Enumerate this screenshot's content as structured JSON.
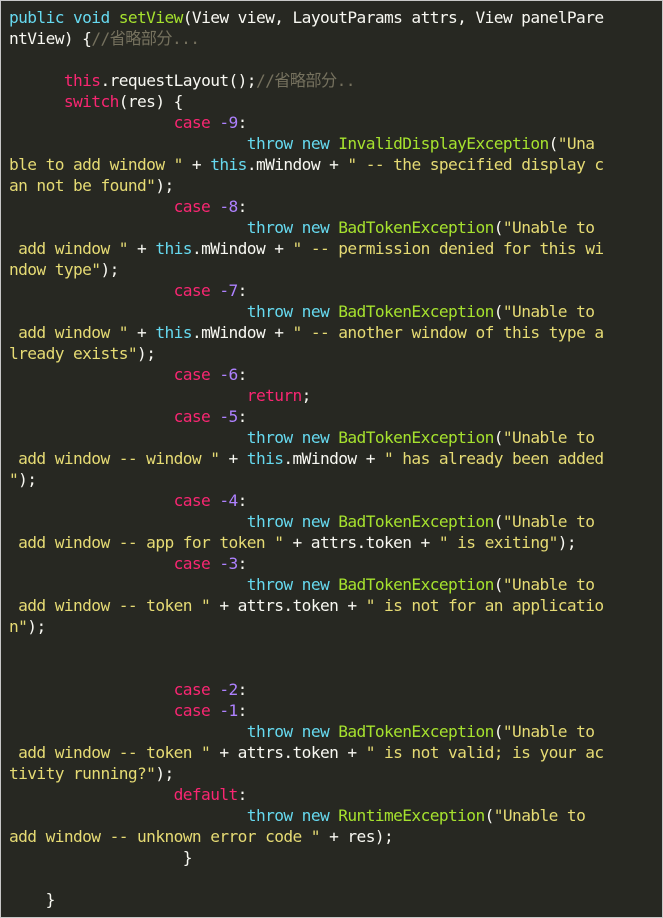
{
  "colors": {
    "background": "#272822",
    "keyword_blue": "#66d9ef",
    "keyword_pink": "#f92672",
    "function_green": "#a6e22e",
    "string_yellow": "#e6db74",
    "number_purple": "#ae81ff",
    "comment_gray": "#75715e",
    "plain": "#f8f8f2"
  },
  "lines": [
    [
      {
        "t": "kw-blue",
        "v": "public void "
      },
      {
        "t": "fn",
        "v": "setView"
      },
      {
        "t": "pl",
        "v": "(View view, LayoutParams attrs, View panelPare"
      }
    ],
    [
      {
        "t": "pl",
        "v": "ntView) {"
      },
      {
        "t": "cmt",
        "v": "//省略部分..."
      }
    ],
    [
      {
        "t": "pl",
        "v": ""
      }
    ],
    [
      {
        "t": "pl",
        "v": "      "
      },
      {
        "t": "kw-pink",
        "v": "this"
      },
      {
        "t": "pl",
        "v": ".requestLayout();"
      },
      {
        "t": "cmt",
        "v": "//省略部分.."
      }
    ],
    [
      {
        "t": "pl",
        "v": "      "
      },
      {
        "t": "kw-pink",
        "v": "switch"
      },
      {
        "t": "pl",
        "v": "(res) {"
      }
    ],
    [
      {
        "t": "pl",
        "v": "                  "
      },
      {
        "t": "kw-pink",
        "v": "case "
      },
      {
        "t": "num",
        "v": "-9"
      },
      {
        "t": "pl",
        "v": ":"
      }
    ],
    [
      {
        "t": "pl",
        "v": "                          "
      },
      {
        "t": "kw-blue",
        "v": "throw new "
      },
      {
        "t": "cls",
        "v": "InvalidDisplayException"
      },
      {
        "t": "pl",
        "v": "("
      },
      {
        "t": "str",
        "v": "\"Una"
      }
    ],
    [
      {
        "t": "str",
        "v": "ble to add window \""
      },
      {
        "t": "pl",
        "v": " + "
      },
      {
        "t": "kw-blue",
        "v": "this"
      },
      {
        "t": "pl",
        "v": ".mWindow + "
      },
      {
        "t": "str",
        "v": "\" -- the specified display c"
      }
    ],
    [
      {
        "t": "str",
        "v": "an not be found\""
      },
      {
        "t": "pl",
        "v": ");"
      }
    ],
    [
      {
        "t": "pl",
        "v": "                  "
      },
      {
        "t": "kw-pink",
        "v": "case "
      },
      {
        "t": "num",
        "v": "-8"
      },
      {
        "t": "pl",
        "v": ":"
      }
    ],
    [
      {
        "t": "pl",
        "v": "                          "
      },
      {
        "t": "kw-blue",
        "v": "throw new "
      },
      {
        "t": "cls",
        "v": "BadTokenException"
      },
      {
        "t": "pl",
        "v": "("
      },
      {
        "t": "str",
        "v": "\"Unable to"
      }
    ],
    [
      {
        "t": "str",
        "v": " add window \""
      },
      {
        "t": "pl",
        "v": " + "
      },
      {
        "t": "kw-blue",
        "v": "this"
      },
      {
        "t": "pl",
        "v": ".mWindow + "
      },
      {
        "t": "str",
        "v": "\" -- permission denied for this wi"
      }
    ],
    [
      {
        "t": "str",
        "v": "ndow type\""
      },
      {
        "t": "pl",
        "v": ");"
      }
    ],
    [
      {
        "t": "pl",
        "v": "                  "
      },
      {
        "t": "kw-pink",
        "v": "case "
      },
      {
        "t": "num",
        "v": "-7"
      },
      {
        "t": "pl",
        "v": ":"
      }
    ],
    [
      {
        "t": "pl",
        "v": "                          "
      },
      {
        "t": "kw-blue",
        "v": "throw new "
      },
      {
        "t": "cls",
        "v": "BadTokenException"
      },
      {
        "t": "pl",
        "v": "("
      },
      {
        "t": "str",
        "v": "\"Unable to"
      }
    ],
    [
      {
        "t": "str",
        "v": " add window \""
      },
      {
        "t": "pl",
        "v": " + "
      },
      {
        "t": "kw-blue",
        "v": "this"
      },
      {
        "t": "pl",
        "v": ".mWindow + "
      },
      {
        "t": "str",
        "v": "\" -- another window of this type a"
      }
    ],
    [
      {
        "t": "str",
        "v": "lready exists\""
      },
      {
        "t": "pl",
        "v": ");"
      }
    ],
    [
      {
        "t": "pl",
        "v": "                  "
      },
      {
        "t": "kw-pink",
        "v": "case "
      },
      {
        "t": "num",
        "v": "-6"
      },
      {
        "t": "pl",
        "v": ":"
      }
    ],
    [
      {
        "t": "pl",
        "v": "                          "
      },
      {
        "t": "kw-pink",
        "v": "return"
      },
      {
        "t": "pl",
        "v": ";"
      }
    ],
    [
      {
        "t": "pl",
        "v": "                  "
      },
      {
        "t": "kw-pink",
        "v": "case "
      },
      {
        "t": "num",
        "v": "-5"
      },
      {
        "t": "pl",
        "v": ":"
      }
    ],
    [
      {
        "t": "pl",
        "v": "                          "
      },
      {
        "t": "kw-blue",
        "v": "throw new "
      },
      {
        "t": "cls",
        "v": "BadTokenException"
      },
      {
        "t": "pl",
        "v": "("
      },
      {
        "t": "str",
        "v": "\"Unable to"
      }
    ],
    [
      {
        "t": "str",
        "v": " add window -- window \""
      },
      {
        "t": "pl",
        "v": " + "
      },
      {
        "t": "kw-blue",
        "v": "this"
      },
      {
        "t": "pl",
        "v": ".mWindow + "
      },
      {
        "t": "str",
        "v": "\" has already been added"
      }
    ],
    [
      {
        "t": "str",
        "v": "\""
      },
      {
        "t": "pl",
        "v": ");"
      }
    ],
    [
      {
        "t": "pl",
        "v": "                  "
      },
      {
        "t": "kw-pink",
        "v": "case "
      },
      {
        "t": "num",
        "v": "-4"
      },
      {
        "t": "pl",
        "v": ":"
      }
    ],
    [
      {
        "t": "pl",
        "v": "                          "
      },
      {
        "t": "kw-blue",
        "v": "throw new "
      },
      {
        "t": "cls",
        "v": "BadTokenException"
      },
      {
        "t": "pl",
        "v": "("
      },
      {
        "t": "str",
        "v": "\"Unable to"
      }
    ],
    [
      {
        "t": "str",
        "v": " add window -- app for token \""
      },
      {
        "t": "pl",
        "v": " + attrs.token + "
      },
      {
        "t": "str",
        "v": "\" is exiting\""
      },
      {
        "t": "pl",
        "v": ");"
      }
    ],
    [
      {
        "t": "pl",
        "v": "                  "
      },
      {
        "t": "kw-pink",
        "v": "case "
      },
      {
        "t": "num",
        "v": "-3"
      },
      {
        "t": "pl",
        "v": ":"
      }
    ],
    [
      {
        "t": "pl",
        "v": "                          "
      },
      {
        "t": "kw-blue",
        "v": "throw new "
      },
      {
        "t": "cls",
        "v": "BadTokenException"
      },
      {
        "t": "pl",
        "v": "("
      },
      {
        "t": "str",
        "v": "\"Unable to"
      }
    ],
    [
      {
        "t": "str",
        "v": " add window -- token \""
      },
      {
        "t": "pl",
        "v": " + attrs.token + "
      },
      {
        "t": "str",
        "v": "\" is not for an applicatio"
      }
    ],
    [
      {
        "t": "str",
        "v": "n\""
      },
      {
        "t": "pl",
        "v": ");"
      }
    ],
    [
      {
        "t": "pl",
        "v": ""
      }
    ],
    [
      {
        "t": "pl",
        "v": ""
      }
    ],
    [
      {
        "t": "pl",
        "v": "                  "
      },
      {
        "t": "kw-pink",
        "v": "case "
      },
      {
        "t": "num",
        "v": "-2"
      },
      {
        "t": "pl",
        "v": ":"
      }
    ],
    [
      {
        "t": "pl",
        "v": "                  "
      },
      {
        "t": "kw-pink",
        "v": "case "
      },
      {
        "t": "num",
        "v": "-1"
      },
      {
        "t": "pl",
        "v": ":"
      }
    ],
    [
      {
        "t": "pl",
        "v": "                          "
      },
      {
        "t": "kw-blue",
        "v": "throw new "
      },
      {
        "t": "cls",
        "v": "BadTokenException"
      },
      {
        "t": "pl",
        "v": "("
      },
      {
        "t": "str",
        "v": "\"Unable to"
      }
    ],
    [
      {
        "t": "str",
        "v": " add window -- token \""
      },
      {
        "t": "pl",
        "v": " + attrs.token + "
      },
      {
        "t": "str",
        "v": "\" is not valid; is your ac"
      }
    ],
    [
      {
        "t": "str",
        "v": "tivity running?\""
      },
      {
        "t": "pl",
        "v": ");"
      }
    ],
    [
      {
        "t": "pl",
        "v": "                  "
      },
      {
        "t": "kw-pink",
        "v": "default"
      },
      {
        "t": "pl",
        "v": ":"
      }
    ],
    [
      {
        "t": "pl",
        "v": "                          "
      },
      {
        "t": "kw-blue",
        "v": "throw new "
      },
      {
        "t": "cls",
        "v": "RuntimeException"
      },
      {
        "t": "pl",
        "v": "("
      },
      {
        "t": "str",
        "v": "\"Unable to"
      }
    ],
    [
      {
        "t": "str",
        "v": "add window -- unknown error code \""
      },
      {
        "t": "pl",
        "v": " + res);"
      }
    ],
    [
      {
        "t": "pl",
        "v": "                   }"
      }
    ],
    [
      {
        "t": "pl",
        "v": ""
      }
    ],
    [
      {
        "t": "pl",
        "v": "    }"
      }
    ]
  ]
}
